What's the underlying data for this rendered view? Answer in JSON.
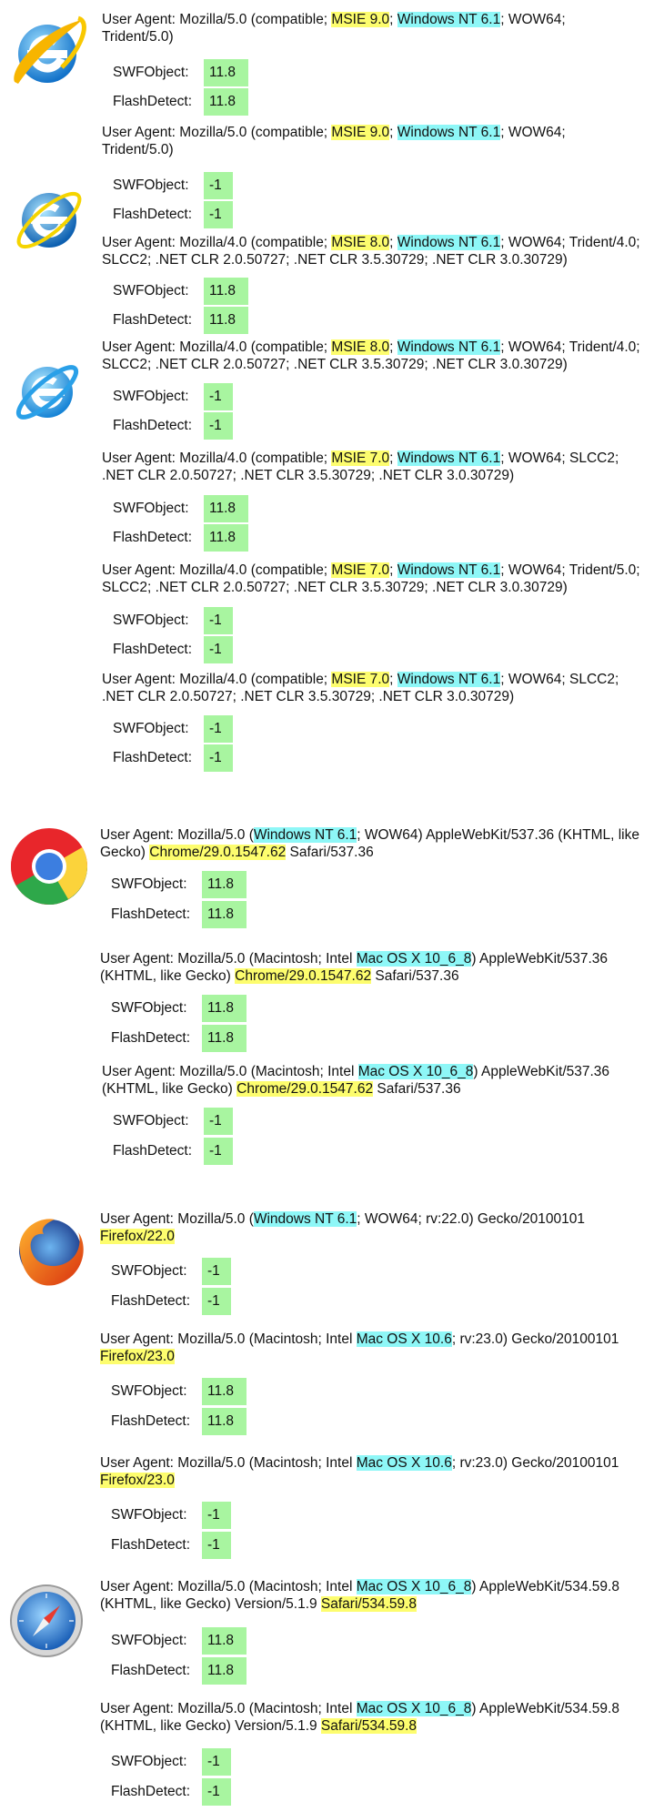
{
  "labels": {
    "ua_prefix": "User Agent:",
    "swf": "SWFObject:",
    "flash": "FlashDetect:"
  },
  "entries": [
    {
      "browser": "ie9",
      "ua": [
        "Mozilla/5.0 (compatible; ",
        "MSIE 9.0",
        "; ",
        "Windows NT 6.1",
        "; WOW64;",
        "Trident/5.0)"
      ],
      "swf": "11.8",
      "flash": "11.8"
    },
    {
      "browser": "ie9",
      "ua": [
        "Mozilla/5.0 (compatible; ",
        "MSIE 9.0",
        "; ",
        "Windows NT 6.1",
        "; WOW64;",
        "Trident/5.0)"
      ],
      "swf": "-1",
      "flash": "-1"
    },
    {
      "browser": "ie8",
      "ua": [
        "Mozilla/4.0 (compatible; ",
        "MSIE 8.0",
        "; ",
        "Windows NT 6.1",
        "; WOW64; Trident/4.0;",
        "SLCC2; .NET CLR 2.0.50727; .NET CLR 3.5.30729; .NET CLR 3.0.30729)"
      ],
      "swf": "11.8",
      "flash": "11.8"
    },
    {
      "browser": "ie8",
      "ua": [
        "Mozilla/4.0 (compatible; ",
        "MSIE 8.0",
        "; ",
        "Windows NT 6.1",
        "; WOW64; Trident/4.0;",
        "SLCC2; .NET CLR 2.0.50727; .NET CLR 3.5.30729; .NET CLR 3.0.30729)"
      ],
      "swf": "-1",
      "flash": "-1"
    },
    {
      "browser": "ie7",
      "ua": [
        "Mozilla/4.0 (compatible; ",
        "MSIE 7.0",
        "; ",
        "Windows NT 6.1",
        "; WOW64; SLCC2;",
        ".NET CLR 2.0.50727; .NET CLR 3.5.30729; .NET CLR 3.0.30729)"
      ],
      "swf": "11.8",
      "flash": "11.8"
    },
    {
      "browser": "ie7",
      "ua": [
        "Mozilla/4.0 (compatible; ",
        "MSIE 7.0",
        "; ",
        "Windows NT 6.1",
        "; WOW64; Trident/5.0;",
        "SLCC2; .NET CLR 2.0.50727; .NET CLR 3.5.30729; .NET CLR 3.0.30729)"
      ],
      "swf": "-1",
      "flash": "-1"
    },
    {
      "browser": "ie7",
      "ua": [
        "Mozilla/4.0 (compatible; ",
        "MSIE 7.0",
        "; ",
        "Windows NT 6.1",
        "; WOW64; SLCC2;",
        ".NET CLR 2.0.50727; .NET CLR 3.5.30729; .NET CLR 3.0.30729)"
      ],
      "swf": "-1",
      "flash": "-1"
    },
    {
      "browser": "chrome",
      "ua": [
        "Mozilla/5.0 (",
        "Windows NT 6.1",
        "; WOW64) AppleWebKit/537.36 (KHTML, like",
        "Gecko) ",
        "Chrome/29.0.1547.62",
        " Safari/537.36"
      ],
      "swf": "11.8",
      "flash": "11.8"
    },
    {
      "browser": "chrome",
      "ua": [
        "Mozilla/5.0 (Macintosh; Intel ",
        "Mac OS X 10_6_8",
        ") AppleWebKit/537.36",
        "(KHTML, like Gecko) ",
        "Chrome/29.0.1547.62",
        " Safari/537.36"
      ],
      "swf": "11.8",
      "flash": "11.8"
    },
    {
      "browser": "chrome",
      "ua": [
        "Mozilla/5.0 (Macintosh; Intel ",
        "Mac OS X 10_6_8",
        ") AppleWebKit/537.36",
        "(KHTML, like Gecko) ",
        "Chrome/29.0.1547.62",
        " Safari/537.36"
      ],
      "swf": "-1",
      "flash": "-1"
    },
    {
      "browser": "firefox",
      "ua": [
        "Mozilla/5.0 (",
        "Windows NT 6.1",
        "; WOW64; rv:22.0) Gecko/20100101",
        "Firefox/22.0"
      ],
      "swf": "-1",
      "flash": "-1"
    },
    {
      "browser": "firefox",
      "ua": [
        "Mozilla/5.0 (Macintosh; Intel ",
        "Mac OS X 10.6",
        "; rv:23.0) Gecko/20100101",
        "Firefox/23.0"
      ],
      "swf": "11.8",
      "flash": "11.8"
    },
    {
      "browser": "firefox",
      "ua": [
        "Mozilla/5.0 (Macintosh; Intel ",
        "Mac OS X 10.6",
        "; rv:23.0) Gecko/20100101",
        "Firefox/23.0"
      ],
      "swf": "-1",
      "flash": "-1"
    },
    {
      "browser": "safari",
      "ua": [
        "Mozilla/5.0 (Macintosh; Intel ",
        "Mac OS X 10_6_8",
        ") AppleWebKit/534.59.8",
        "(KHTML, like Gecko) Version/5.1.9 ",
        "Safari/534.59.8"
      ],
      "swf": "11.8",
      "flash": "11.8"
    },
    {
      "browser": "safari",
      "ua": [
        "Mozilla/5.0 (Macintosh; Intel ",
        "Mac OS X 10_6_8",
        ") AppleWebKit/534.59.8",
        "(KHTML, like Gecko) Version/5.1.9 ",
        "Safari/534.59.8"
      ],
      "swf": "-1",
      "flash": "-1"
    }
  ],
  "colors": {
    "os_highlight": "#8ef7f7",
    "browser_highlight": "#fdfd6e",
    "value_bg": "#a8f5a0"
  },
  "icons": [
    "internet-explorer-9-logo-icon",
    "internet-explorer-8-logo-icon",
    "internet-explorer-7-logo-icon",
    "chrome-logo-icon",
    "firefox-logo-icon",
    "safari-logo-icon"
  ]
}
